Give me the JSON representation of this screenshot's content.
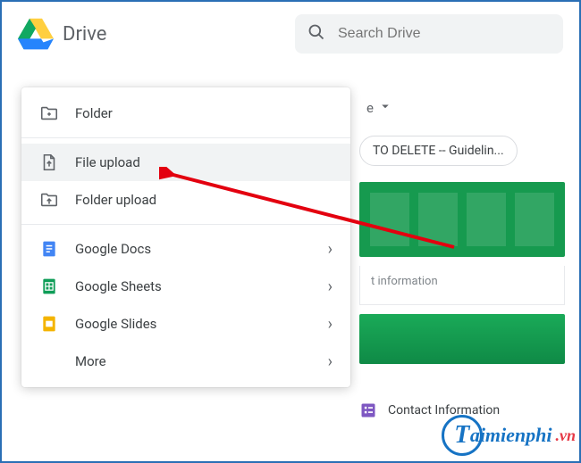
{
  "header": {
    "app_title": "Drive",
    "search_placeholder": "Search Drive"
  },
  "dropdown_remnant": {
    "label": "e"
  },
  "chip": {
    "label": "TO DELETE -- Guidelin..."
  },
  "context_menu": {
    "items": [
      {
        "icon": "folder-plus",
        "label": "Folder",
        "has_submenu": false
      },
      {
        "divider": true
      },
      {
        "icon": "file-upload",
        "label": "File upload",
        "has_submenu": false,
        "highlighted": true
      },
      {
        "icon": "folder-upload",
        "label": "Folder upload",
        "has_submenu": false
      },
      {
        "divider": true
      },
      {
        "icon": "docs",
        "label": "Google Docs",
        "has_submenu": true
      },
      {
        "icon": "sheets",
        "label": "Google Sheets",
        "has_submenu": true
      },
      {
        "icon": "slides",
        "label": "Google Slides",
        "has_submenu": true
      },
      {
        "icon": "none",
        "label": "More",
        "has_submenu": true
      }
    ]
  },
  "info": {
    "row1_label": "t information",
    "row2_label": "Contact Information"
  },
  "watermark": {
    "letter": "T",
    "text": "aimienphi",
    "suffix": ".vn"
  }
}
